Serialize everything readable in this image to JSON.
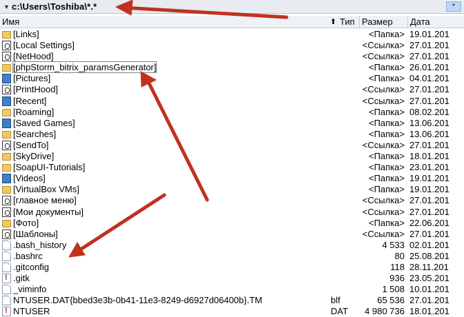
{
  "pathbar": {
    "dropdown": "▼",
    "path": "c:\\Users\\Toshiba\\*.*",
    "filter_btn": "*"
  },
  "columns": {
    "name": "Имя",
    "sort_arrow": "⬆",
    "type": "Тип",
    "size": "Размер",
    "date": "Дата"
  },
  "rows": [
    {
      "icon": "folder",
      "name": "[Links]",
      "type": "",
      "size": "<Папка>",
      "date": "19.01.201"
    },
    {
      "icon": "link",
      "name": "[Local Settings]",
      "type": "",
      "size": "<Ссылка>",
      "date": "27.01.201"
    },
    {
      "icon": "link",
      "name": "[NetHood]",
      "type": "",
      "size": "<Ссылка>",
      "date": "27.01.201"
    },
    {
      "icon": "folder",
      "name": "[phpStorm_bitrix_paramsGenerator]",
      "type": "",
      "size": "<Папка>",
      "date": "26.01.201",
      "selected": true
    },
    {
      "icon": "image",
      "name": "[Pictures]",
      "type": "",
      "size": "<Папка>",
      "date": "04.01.201"
    },
    {
      "icon": "link",
      "name": "[PrintHood]",
      "type": "",
      "size": "<Ссылка>",
      "date": "27.01.201"
    },
    {
      "icon": "image",
      "name": "[Recent]",
      "type": "",
      "size": "<Ссылка>",
      "date": "27.01.201"
    },
    {
      "icon": "folder",
      "name": "[Roaming]",
      "type": "",
      "size": "<Папка>",
      "date": "08.02.201"
    },
    {
      "icon": "image",
      "name": "[Saved Games]",
      "type": "",
      "size": "<Папка>",
      "date": "13.06.201"
    },
    {
      "icon": "folder",
      "name": "[Searches]",
      "type": "",
      "size": "<Папка>",
      "date": "13.06.201"
    },
    {
      "icon": "link",
      "name": "[SendTo]",
      "type": "",
      "size": "<Ссылка>",
      "date": "27.01.201"
    },
    {
      "icon": "folder",
      "name": "[SkyDrive]",
      "type": "",
      "size": "<Папка>",
      "date": "18.01.201"
    },
    {
      "icon": "folder",
      "name": "[SoapUI-Tutorials]",
      "type": "",
      "size": "<Папка>",
      "date": "23.01.201"
    },
    {
      "icon": "image",
      "name": "[Videos]",
      "type": "",
      "size": "<Папка>",
      "date": "19.01.201"
    },
    {
      "icon": "folder",
      "name": "[VirtualBox VMs]",
      "type": "",
      "size": "<Папка>",
      "date": "19.01.201"
    },
    {
      "icon": "link",
      "name": "[главное меню]",
      "type": "",
      "size": "<Ссылка>",
      "date": "27.01.201"
    },
    {
      "icon": "link",
      "name": "[Мои документы]",
      "type": "",
      "size": "<Ссылка>",
      "date": "27.01.201"
    },
    {
      "icon": "folder",
      "name": "[Фото]",
      "type": "",
      "size": "<Папка>",
      "date": "22.06.201"
    },
    {
      "icon": "link",
      "name": "[Шаблоны]",
      "type": "",
      "size": "<Ссылка>",
      "date": "27.01.201"
    },
    {
      "icon": "file",
      "name": ".bash_history",
      "type": "",
      "size": "4 533",
      "date": "02.01.201"
    },
    {
      "icon": "file",
      "name": ".bashrc",
      "type": "",
      "size": "80",
      "date": "25.08.201"
    },
    {
      "icon": "file",
      "name": ".gitconfig",
      "type": "",
      "size": "118",
      "date": "28.11.201"
    },
    {
      "icon": "red",
      "name": ".gitk",
      "type": "",
      "size": "936",
      "date": "23.05.201"
    },
    {
      "icon": "file",
      "name": "_viminfo",
      "type": "",
      "size": "1 508",
      "date": "10.01.201"
    },
    {
      "icon": "file",
      "name": "NTUSER.DAT{bbed3e3b-0b41-11e3-8249-d6927d06400b}.TM",
      "type": "blf",
      "size": "65 536",
      "date": "27.01.201"
    },
    {
      "icon": "red",
      "name": "NTUSER",
      "type": "DAT",
      "size": "4 980 736",
      "date": "18.01.201"
    }
  ],
  "colors": {
    "arrow": "#c0321f",
    "header_bg": "#eef2f7",
    "pathbar_bg": "#e8ecf2"
  }
}
